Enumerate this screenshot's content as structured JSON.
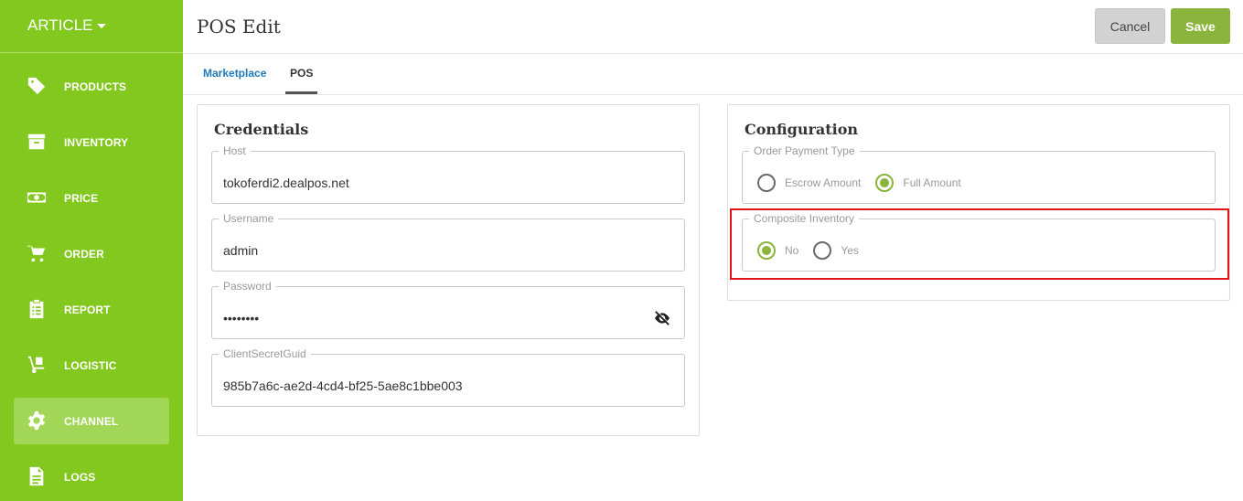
{
  "sidebar": {
    "brand": "ARTICLE",
    "items": [
      {
        "label": "PRODUCTS",
        "icon": "tag-icon"
      },
      {
        "label": "INVENTORY",
        "icon": "archive-box-icon"
      },
      {
        "label": "PRICE",
        "icon": "money-icon"
      },
      {
        "label": "ORDER",
        "icon": "cart-icon"
      },
      {
        "label": "REPORT",
        "icon": "clipboard-icon"
      },
      {
        "label": "LOGISTIC",
        "icon": "hand-truck-icon"
      },
      {
        "label": "CHANNEL",
        "icon": "gear-icon",
        "active": true
      },
      {
        "label": "LOGS",
        "icon": "document-icon"
      }
    ]
  },
  "header": {
    "title": "POS Edit",
    "cancel_label": "Cancel",
    "save_label": "Save"
  },
  "tabs": [
    {
      "label": "Marketplace",
      "active": false
    },
    {
      "label": "POS",
      "active": true
    }
  ],
  "credentials": {
    "title": "Credentials",
    "host": {
      "label": "Host",
      "value": "tokoferdi2.dealpos.net"
    },
    "username": {
      "label": "Username",
      "value": "admin"
    },
    "password": {
      "label": "Password",
      "value": "••••••••"
    },
    "client_secret": {
      "label": "ClientSecretGuid",
      "value": "985b7a6c-ae2d-4cd4-bf25-5ae8c1bbe003"
    }
  },
  "configuration": {
    "title": "Configuration",
    "order_payment_type": {
      "label": "Order Payment Type",
      "options": [
        {
          "label": "Escrow Amount",
          "selected": false
        },
        {
          "label": "Full Amount",
          "selected": true
        }
      ]
    },
    "composite_inventory": {
      "label": "Composite Inventory",
      "options": [
        {
          "label": "No",
          "selected": true
        },
        {
          "label": "Yes",
          "selected": false
        }
      ]
    }
  },
  "colors": {
    "sidebar": "#83c81e",
    "accent": "#8ab43c",
    "link": "#1f7ab8",
    "highlight": "#e0141b"
  }
}
